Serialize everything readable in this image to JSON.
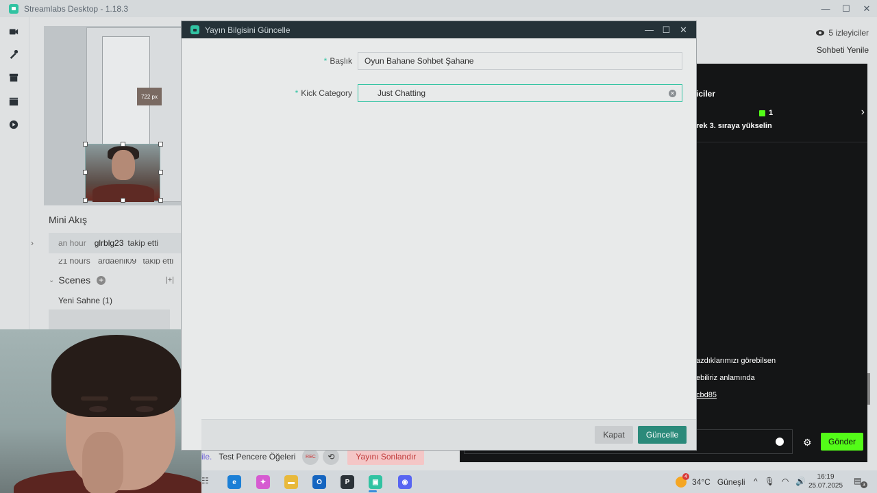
{
  "app": {
    "title": "Streamlabs Desktop - 1.18.3",
    "controls": {
      "minimize": "—",
      "maximize": "☐",
      "close": "✕"
    }
  },
  "leftnav": {
    "items": [
      {
        "name": "editor-icon"
      },
      {
        "name": "themes-icon"
      },
      {
        "name": "store-icon"
      },
      {
        "name": "studio-mode-icon"
      },
      {
        "name": "play-icon"
      }
    ]
  },
  "editor": {
    "preview_label": "722 px",
    "mini_feed_title": "Mini Akış",
    "activity": [
      {
        "time": "an hour",
        "user": "glrblg23",
        "action": "takip etti"
      },
      {
        "time": "21 hours",
        "user": "ardaenil09",
        "action": "takip etti"
      }
    ],
    "scenes_title": "Scenes",
    "scenes": [
      "Yeni Sahne (1)"
    ],
    "expand_icon": "›",
    "collapse_icon": "⌄",
    "fit_icon": "|+|"
  },
  "bottombar": {
    "fragment": "ile.",
    "test_label": "Test Pencere Öğeleri",
    "rec_label": "REC",
    "replay_icon": "⟲",
    "end_stream_label": "Yayını Sonlandır"
  },
  "right_panel": {
    "viewers": "5 izleyiciler",
    "refresh_chat": "Sohbeti Yenile",
    "chat": {
      "leaders_title": "iciler",
      "gift_count": "1",
      "promo": "rek 3. sıraya yükselin",
      "arrow": "›",
      "messages": [
        {
          "text": "azdıklarımızı görebilsen",
          "link": false
        },
        {
          "text": "ebiliriz anlamında",
          "link": false
        },
        {
          "text": "cbd85",
          "link": true
        }
      ],
      "send_label": "Gönder",
      "gear_icon": "⚙"
    }
  },
  "dialog": {
    "title": "Yayın Bilgisini Güncelle",
    "controls": {
      "minimize": "—",
      "maximize": "☐",
      "close": "✕"
    },
    "fields": {
      "title": {
        "label": "Başlık",
        "value": "Oyun Bahane Sohbet Şahane",
        "required": "*"
      },
      "category": {
        "label": "Kick Category",
        "value": "Just Chatting",
        "required": "*"
      }
    },
    "buttons": {
      "cancel": "Kapat",
      "update": "Güncelle"
    }
  },
  "taskbar": {
    "widgets_icon": "☷",
    "apps": [
      {
        "name": "edge-icon",
        "color": "#1b7fd6",
        "glyph": "e"
      },
      {
        "name": "copilot-icon",
        "color": "#d65bd1",
        "glyph": "✦"
      },
      {
        "name": "file-explorer-icon",
        "color": "#e8b93c",
        "glyph": "▬"
      },
      {
        "name": "outlook-icon",
        "color": "#1565c0",
        "glyph": "O"
      },
      {
        "name": "playstation-icon",
        "color": "#2b3238",
        "glyph": "P"
      },
      {
        "name": "streamlabs-icon",
        "color": "#31c3a2",
        "glyph": "▣"
      },
      {
        "name": "discord-icon",
        "color": "#5865f2",
        "glyph": "◉"
      }
    ],
    "weather": {
      "badge": "4",
      "temp": "34°C",
      "condition": "Güneşli"
    },
    "tray": {
      "chevron": "^",
      "mic": "🎙",
      "wifi": "◠",
      "volume": "🔊"
    },
    "clock": {
      "time": "16:19",
      "date": "25.07.2025"
    },
    "notifications": {
      "icon": "▤",
      "count": "3"
    }
  }
}
